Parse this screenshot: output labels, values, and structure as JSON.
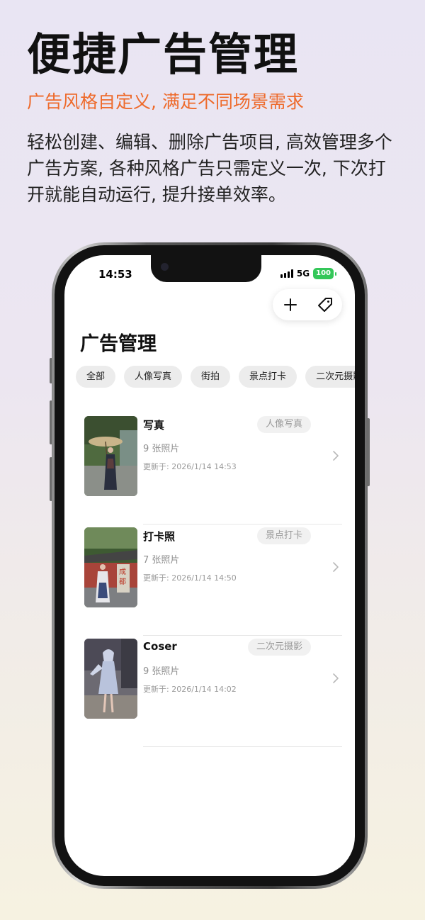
{
  "hero": {
    "title": "便捷广告管理",
    "subtitle": "广告风格自定义, 满足不同场景需求",
    "description": "轻松创建、编辑、删除广告项目, 高效管理多个广告方案, 各种风格广告只需定义一次, 下次打开就能自动运行, 提升接单效率。",
    "subtitle_color": "#ee6a2b"
  },
  "status_bar": {
    "time": "14:53",
    "network": "5G",
    "battery": "100",
    "battery_color": "#34c759"
  },
  "toolbar": {
    "add_icon": "plus-icon",
    "tag_icon": "tag-icon"
  },
  "page": {
    "title": "广告管理"
  },
  "filters": [
    "全部",
    "人像写真",
    "街拍",
    "景点打卡",
    "二次元摄影"
  ],
  "items": [
    {
      "name": "写真",
      "tag": "人像写真",
      "count": "9 张照片",
      "updated": "更新于: 2026/1/14 14:53"
    },
    {
      "name": "打卡照",
      "tag": "景点打卡",
      "count": "7 张照片",
      "updated": "更新于: 2026/1/14 14:50"
    },
    {
      "name": "Coser",
      "tag": "二次元摄影",
      "count": "9 张照片",
      "updated": "更新于: 2026/1/14 14:02"
    }
  ]
}
